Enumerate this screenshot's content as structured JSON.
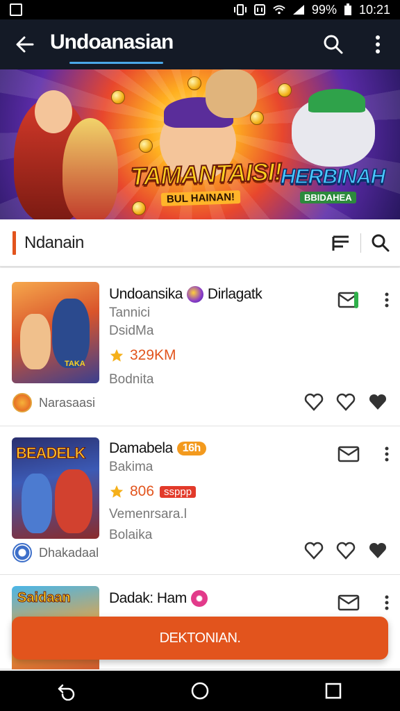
{
  "status_bar": {
    "battery": "99%",
    "time": "10:21"
  },
  "app_bar": {
    "title": "Undoanasian"
  },
  "hero": {
    "title_left": "TAMANTAISI!",
    "subtitle_left": "BUL HAINAN!",
    "title_right": "HERBINAH",
    "subtitle_right": "BBIDAHEA"
  },
  "section": {
    "label": "Ndanain"
  },
  "items": [
    {
      "name": "Undoansika",
      "name_suffix": "Dirlagatk",
      "line1": "Tannici",
      "line2": "DsidMa",
      "rating": "329KM",
      "category": "Bodnita",
      "thumb_text": "TAKA",
      "publisher": "Narasaasi"
    },
    {
      "name": "Damabela",
      "tag": "16h",
      "line1": "Bakima",
      "rating": "806",
      "rating_badge": "ssppp",
      "line2": "Vemenrsara.l",
      "category": "Bolaika",
      "thumb_text": "BEADELK",
      "publisher": "Dhakadaal"
    },
    {
      "name": "Dadak: Ham",
      "thumb_text": "Saidaan"
    }
  ],
  "cta": {
    "label": "DEKTONIAN."
  },
  "colors": {
    "accent": "#e2541d",
    "appbar": "#141a26",
    "tag": "#f39a1e"
  }
}
